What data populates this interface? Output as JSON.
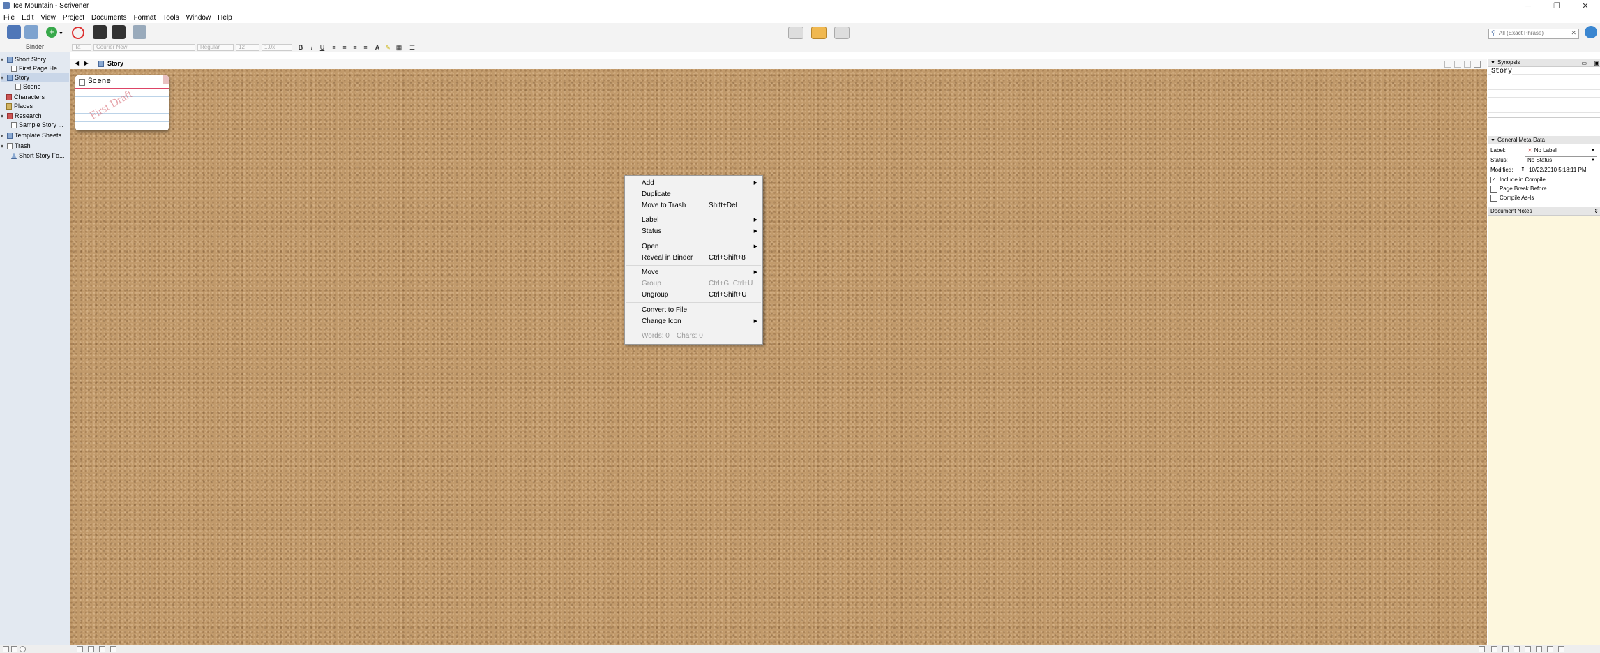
{
  "window": {
    "title": "Ice Mountain - Scrivener",
    "minimize": "─",
    "restore": "❐",
    "close": "✕"
  },
  "menubar": [
    "File",
    "Edit",
    "View",
    "Project",
    "Documents",
    "Format",
    "Tools",
    "Window",
    "Help"
  ],
  "toolbar": {
    "search_placeholder": "All (Exact Phrase)"
  },
  "formatbar": {
    "style": "Ta",
    "font": "Courier New",
    "weight": "Regular",
    "size": "12",
    "spacing": "1.0x"
  },
  "binder": {
    "header": "Binder",
    "items": [
      {
        "label": "Short Story",
        "arrow": "▾"
      },
      {
        "label": "First Page He...",
        "arrow": ""
      },
      {
        "label": "Story",
        "arrow": "▾"
      },
      {
        "label": "Scene",
        "arrow": ""
      },
      {
        "label": "Characters",
        "arrow": ""
      },
      {
        "label": "Places",
        "arrow": ""
      },
      {
        "label": "Research",
        "arrow": "▾"
      },
      {
        "label": "Sample Story ...",
        "arrow": ""
      },
      {
        "label": "Template Sheets",
        "arrow": "▸"
      },
      {
        "label": "Trash",
        "arrow": "▾"
      },
      {
        "label": "Short Story Fo...",
        "arrow": ""
      }
    ]
  },
  "editor": {
    "title": "Story",
    "back": "◀",
    "forward": "▶"
  },
  "card": {
    "title": "Scene",
    "stamp": "First Draft"
  },
  "context_menu": {
    "items": [
      {
        "label": "Add",
        "shortcut": "",
        "submenu": true,
        "disabled": false
      },
      {
        "label": "Duplicate",
        "shortcut": "",
        "submenu": false,
        "disabled": false
      },
      {
        "label": "Move to Trash",
        "shortcut": "Shift+Del",
        "submenu": false,
        "disabled": false
      },
      {
        "label": "Label",
        "shortcut": "",
        "submenu": true,
        "disabled": false
      },
      {
        "label": "Status",
        "shortcut": "",
        "submenu": true,
        "disabled": false
      },
      {
        "label": "Open",
        "shortcut": "",
        "submenu": true,
        "disabled": false
      },
      {
        "label": "Reveal in Binder",
        "shortcut": "Ctrl+Shift+8",
        "submenu": false,
        "disabled": false
      },
      {
        "label": "Move",
        "shortcut": "",
        "submenu": true,
        "disabled": false
      },
      {
        "label": "Group",
        "shortcut": "Ctrl+G, Ctrl+U",
        "submenu": false,
        "disabled": true
      },
      {
        "label": "Ungroup",
        "shortcut": "Ctrl+Shift+U",
        "submenu": false,
        "disabled": false
      },
      {
        "label": "Convert to File",
        "shortcut": "",
        "submenu": false,
        "disabled": false
      },
      {
        "label": "Change Icon",
        "shortcut": "",
        "submenu": true,
        "disabled": false
      }
    ],
    "words": "Words: 0",
    "chars": "Chars: 0"
  },
  "inspector": {
    "synopsis_header": "Synopsis",
    "synopsis_title": "Story",
    "meta_header": "General Meta-Data",
    "label_caption": "Label:",
    "label_value": "No Label",
    "status_caption": "Status:",
    "status_value": "No Status",
    "modified_caption": "Modified:",
    "modified_value": "10/22/2010 5:18:11 PM",
    "include_in_compile": "Include in Compile",
    "page_break_before": "Page Break Before",
    "compile_as_is": "Compile As-Is",
    "notes_header": "Document Notes"
  }
}
